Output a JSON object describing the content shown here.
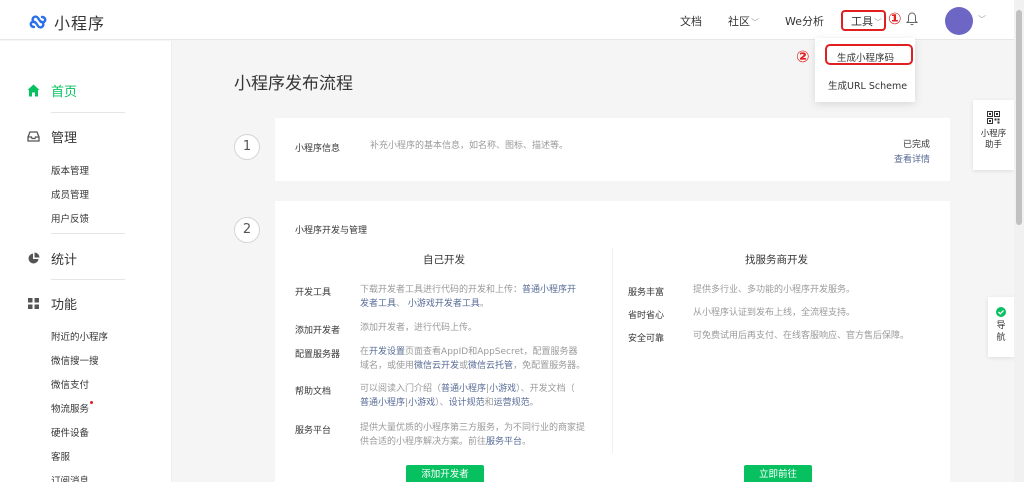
{
  "header": {
    "logo_text": "小程序",
    "nav": {
      "docs": "文档",
      "community": "社区",
      "we_analysis": "We分析",
      "tools": "工具"
    },
    "annotation_1": "①",
    "annotation_2": "②"
  },
  "tools_dropdown": {
    "items": [
      "生成小程序码",
      "生成URL Scheme"
    ]
  },
  "sidebar": {
    "home": "首页",
    "manage": {
      "title": "管理",
      "items": [
        "版本管理",
        "成员管理",
        "用户反馈"
      ]
    },
    "stats": "统计",
    "features": {
      "title": "功能",
      "items": [
        "附近的小程序",
        "微信搜一搜",
        "微信支付",
        "物流服务",
        "硬件设备",
        "客服",
        "订阅消息"
      ]
    }
  },
  "main": {
    "title": "小程序发布流程",
    "step1": {
      "num": "1",
      "label": "小程序信息",
      "desc": "补充小程序的基本信息，如名称、图标、描述等。",
      "status": "已完成",
      "link": "查看详情"
    },
    "step2": {
      "num": "2",
      "label": "小程序开发与管理",
      "left": {
        "title": "自己开发",
        "rows": [
          {
            "label": "开发工具",
            "line1_pre": "下载开发者工具进行代码的开发和上传：",
            "line1_link": "普通小程序开",
            "line2_link1": "发者工具",
            "line2_sep": "、",
            "line2_link2": "小游戏开发者工具",
            "line2_end": "。"
          },
          {
            "label": "添加开发者",
            "line1": "添加开发者，进行代码上传。"
          },
          {
            "label": "配置服务器",
            "line1_pre": "在",
            "line1_link": "开发设置",
            "line1_post": "页面查看AppID和AppSecret，配置服务器",
            "line2_pre": "域名，或使用",
            "line2_link1": "微信云开发",
            "line2_mid": "或",
            "line2_link2": "微信云托管",
            "line2_end": "，免配置服务器。"
          },
          {
            "label": "帮助文档",
            "line1_pre": "可以阅读入门介绍（",
            "line1_link1": "普通小程序",
            "line1_sep": "|",
            "line1_link2": "小游戏",
            "line1_post": "）、开发文档（",
            "line2_link1": "普通小程序",
            "line2_sep": "|",
            "line2_link2": "小游戏",
            "line2_mid": "）、",
            "line2_link3": "设计规范",
            "line2_and": "和",
            "line2_link4": "运营规范",
            "line2_end": "。"
          },
          {
            "label": "服务平台",
            "line1": "提供大量优质的小程序第三方服务，为不同行业的商家提",
            "line2_pre": "供合适的小程序解决方案。前往",
            "line2_link": "服务平台",
            "line2_end": "。"
          }
        ],
        "button": "添加开发者"
      },
      "right": {
        "title": "找服务商开发",
        "rows": [
          {
            "label": "服务丰富",
            "desc": "提供多行业、多功能的小程序开发服务。"
          },
          {
            "label": "省时省心",
            "desc": "从小程序认证到发布上线，全流程支持。"
          },
          {
            "label": "安全可靠",
            "desc": "可免费试用后再支付、在线客服响应、官方售后保障。"
          }
        ],
        "button": "立即前往"
      }
    }
  },
  "floating": {
    "assistant": [
      "小程序",
      "助手"
    ],
    "nav": [
      "导",
      "航"
    ]
  },
  "colors": {
    "accent": "#07c160",
    "link": "#576b95",
    "annotation": "#e02020",
    "avatar": "#6e66c4"
  }
}
